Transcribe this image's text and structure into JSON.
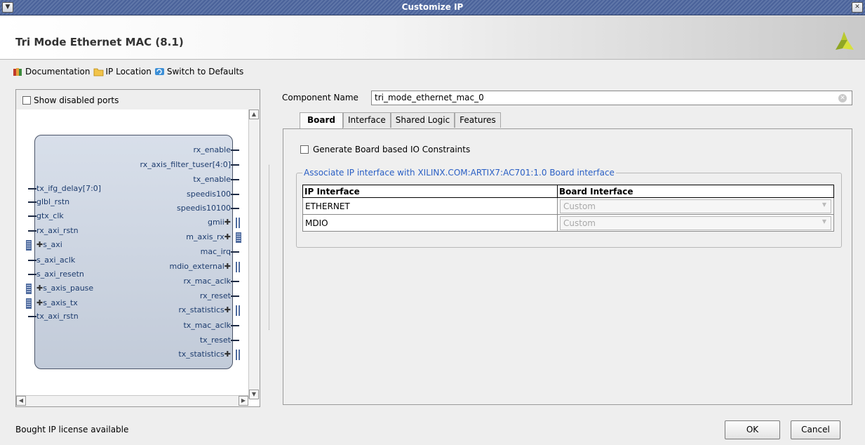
{
  "window": {
    "title": "Customize IP"
  },
  "header": {
    "ip_name": "Tri Mode Ethernet MAC (8.1)"
  },
  "toolbar": {
    "documentation": "Documentation",
    "ip_location": "IP Location",
    "switch_defaults": "Switch to Defaults"
  },
  "symbol_panel": {
    "show_disabled_ports": "Show disabled ports",
    "left_ports": [
      "tx_ifg_delay[7:0]",
      "glbl_rstn",
      "gtx_clk",
      "rx_axi_rstn",
      "s_axi",
      "s_axi_aclk",
      "s_axi_resetn",
      "s_axis_pause",
      "s_axis_tx",
      "tx_axi_rstn"
    ],
    "right_ports": [
      "rx_enable",
      "rx_axis_filter_tuser[4:0]",
      "tx_enable",
      "speedis100",
      "speedis10100",
      "gmii",
      "m_axis_rx",
      "mac_irq",
      "mdio_external",
      "rx_mac_aclk",
      "rx_reset",
      "rx_statistics",
      "tx_mac_aclk",
      "tx_reset",
      "tx_statistics"
    ]
  },
  "config": {
    "component_name_label": "Component Name",
    "component_name_value": "tri_mode_ethernet_mac_0",
    "tabs": [
      "Board",
      "Interface",
      "Shared Logic",
      "Features"
    ],
    "active_tab": "Board",
    "board": {
      "generate_constraints_label": "Generate Board based IO Constraints",
      "fieldset_legend": "Associate IP interface with XILINX.COM:ARTIX7:AC701:1.0 Board interface",
      "columns": [
        "IP Interface",
        "Board Interface"
      ],
      "rows": [
        {
          "ip_interface": "ETHERNET",
          "board_interface": "Custom"
        },
        {
          "ip_interface": "MDIO",
          "board_interface": "Custom"
        }
      ]
    }
  },
  "footer": {
    "status": "Bought IP license available",
    "ok": "OK",
    "cancel": "Cancel"
  }
}
